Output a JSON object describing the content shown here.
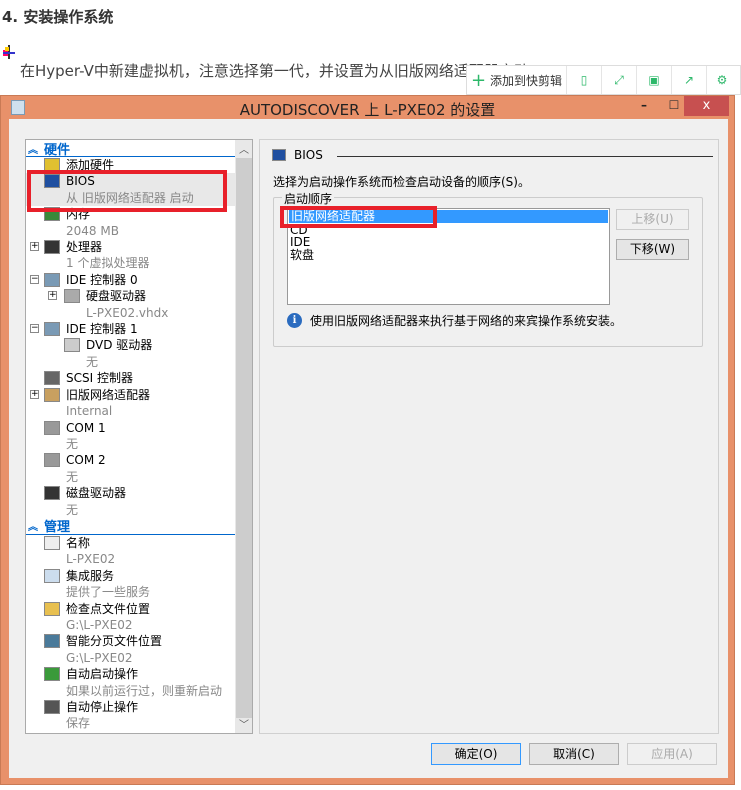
{
  "article": {
    "heading": "4. 安装操作系统",
    "paragraph": "在Hyper-V中新建虚拟机，注意选择第一代，并设置为从旧版网络适配器启动"
  },
  "toolbar": {
    "add_label": "添加到快剪辑",
    "icons": [
      "phone-icon",
      "expand-icon",
      "save-icon",
      "share-icon",
      "gear-icon"
    ],
    "accent": "#2db86a"
  },
  "window": {
    "title": "AUTODISCOVER 上 L-PXE02 的设置",
    "frame_color": "#e8916a",
    "close": "x"
  },
  "tree": {
    "hardware_label": "硬件",
    "management_label": "管理",
    "hardware": [
      {
        "label": "添加硬件",
        "icon": "add-hardware-icon"
      },
      {
        "label": "BIOS",
        "sub": "从 旧版网络适配器 启动",
        "icon": "bios-icon",
        "selected": true
      },
      {
        "label": "内存",
        "sub": "2048 MB",
        "icon": "memory-icon"
      },
      {
        "label": "处理器",
        "sub": "1 个虚拟处理器",
        "icon": "processor-icon",
        "expander": "+"
      },
      {
        "label": "IDE 控制器 0",
        "icon": "ide-controller-icon",
        "expander": "−"
      },
      {
        "label": "硬盘驱动器",
        "sub": "L-PXE02.vhdx",
        "icon": "hard-drive-icon",
        "expander": "+",
        "child": true
      },
      {
        "label": "IDE 控制器 1",
        "icon": "ide-controller-icon",
        "expander": "−"
      },
      {
        "label": "DVD 驱动器",
        "sub": "无",
        "icon": "dvd-icon",
        "child": true
      },
      {
        "label": "SCSI 控制器",
        "icon": "scsi-icon"
      },
      {
        "label": "旧版网络适配器",
        "sub": "Internal",
        "icon": "network-adapter-icon",
        "expander": "+"
      },
      {
        "label": "COM 1",
        "sub": "无",
        "icon": "com-port-icon"
      },
      {
        "label": "COM 2",
        "sub": "无",
        "icon": "com-port-icon"
      },
      {
        "label": "磁盘驱动器",
        "sub": "无",
        "icon": "floppy-icon"
      }
    ],
    "management": [
      {
        "label": "名称",
        "sub": "L-PXE02",
        "icon": "name-icon"
      },
      {
        "label": "集成服务",
        "sub": "提供了一些服务",
        "icon": "integration-services-icon"
      },
      {
        "label": "检查点文件位置",
        "sub": "G:\\L-PXE02",
        "icon": "checkpoint-folder-icon"
      },
      {
        "label": "智能分页文件位置",
        "sub": "G:\\L-PXE02",
        "icon": "smart-paging-icon"
      },
      {
        "label": "自动启动操作",
        "sub": "如果以前运行过，则重新启动",
        "icon": "auto-start-icon"
      },
      {
        "label": "自动停止操作",
        "sub": "保存",
        "icon": "auto-stop-icon"
      }
    ]
  },
  "bios": {
    "section_title": "BIOS",
    "description": "选择为启动操作系统而检查启动设备的顺序(S)。",
    "group_label": "启动顺序",
    "boot_order": [
      "旧版网络适配器",
      "CD",
      "IDE",
      "软盘"
    ],
    "selected_index": 0,
    "move_up": "上移(U)",
    "move_down": "下移(W)",
    "info": "使用旧版网络适配器来执行基于网络的来宾操作系统安装。"
  },
  "buttons": {
    "ok": "确定(O)",
    "cancel": "取消(C)",
    "apply": "应用(A)"
  }
}
